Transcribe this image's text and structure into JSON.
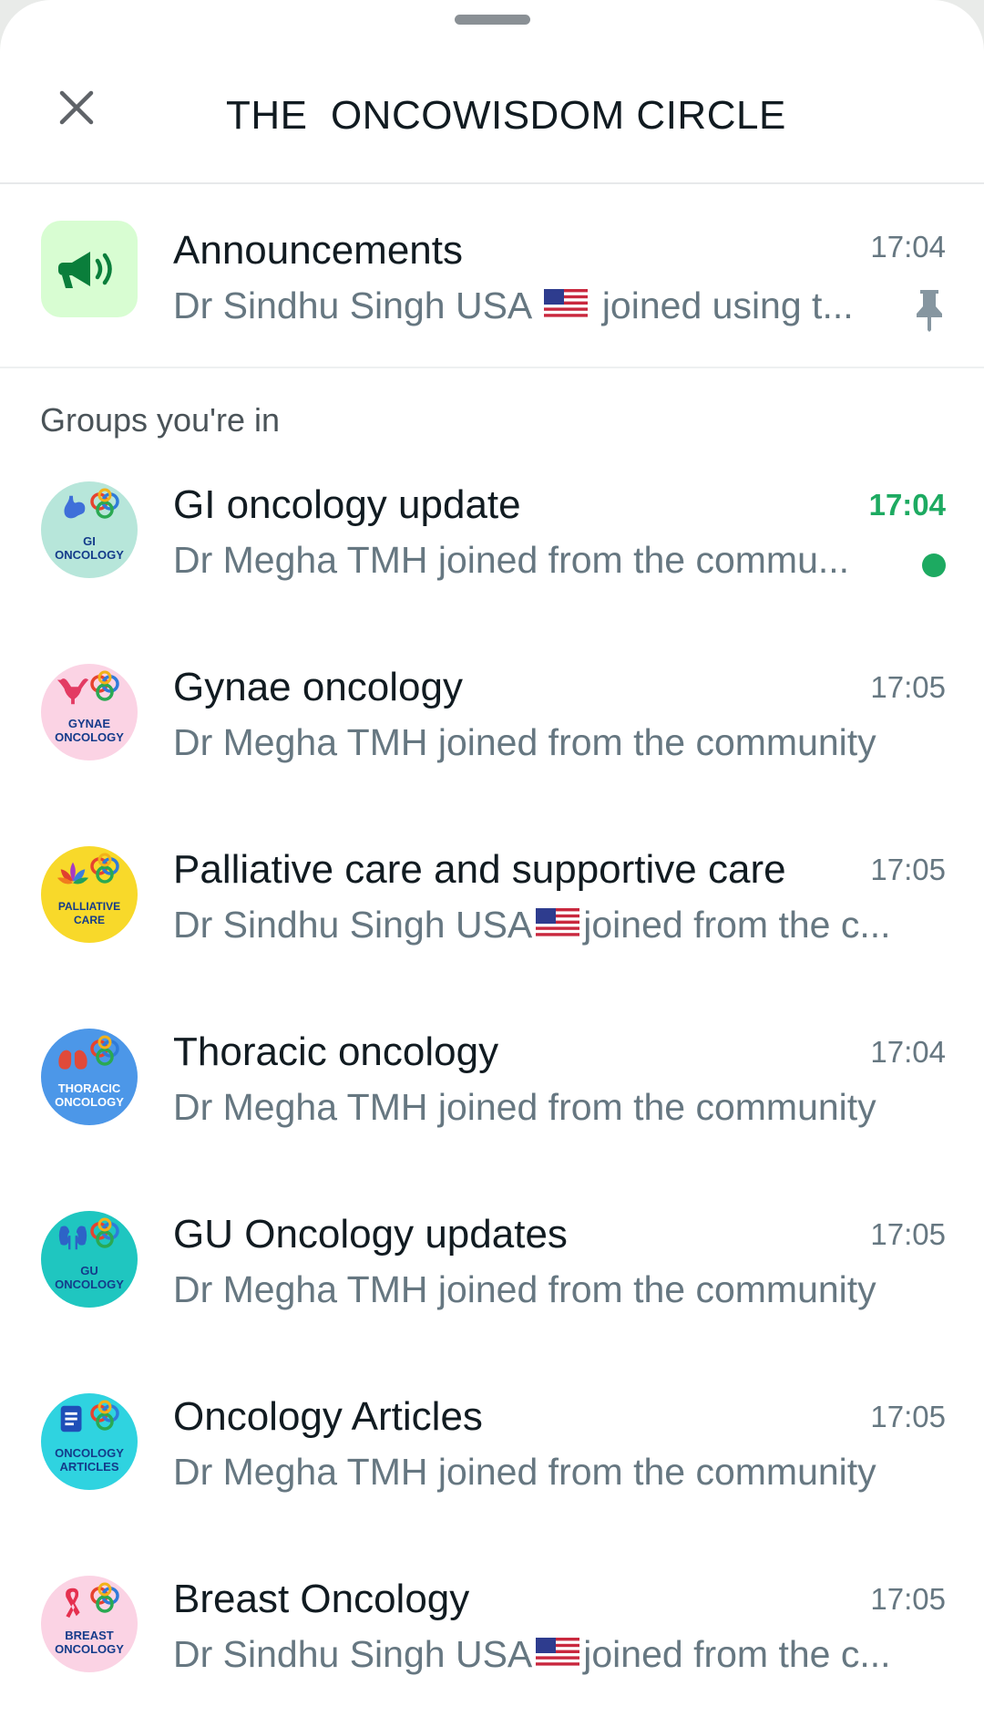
{
  "header": {
    "title": "THE  ONCOWISDOM CIRCLE"
  },
  "announcements": {
    "title": "Announcements",
    "subtitle_before_flag": "Dr Sindhu Singh USA",
    "subtitle_after_flag": "joined using t...",
    "time": "17:04"
  },
  "section_label": "Groups you're in",
  "groups": [
    {
      "title": "GI oncology update",
      "sub_before": "Dr Megha TMH joined from the commu...",
      "sub_after": "",
      "flag": false,
      "time": "17:04",
      "unread": true,
      "avatar_lines": [
        "GI",
        "ONCOLOGY"
      ],
      "avatar_bg": "#b7e6da",
      "avatar_icon": "stomach-icon"
    },
    {
      "title": "Gynae oncology",
      "sub_before": "Dr Megha TMH joined from the community",
      "sub_after": "",
      "flag": false,
      "time": "17:05",
      "unread": false,
      "avatar_lines": [
        "GYNAE",
        "ONCOLOGY"
      ],
      "avatar_bg": "#fbd3e4",
      "avatar_icon": "uterus-icon"
    },
    {
      "title": "Palliative care and supportive care",
      "sub_before": "Dr Sindhu Singh USA",
      "sub_after": "joined from the c...",
      "flag": true,
      "time": "17:05",
      "unread": false,
      "avatar_lines": [
        "PALLIATIVE",
        "CARE"
      ],
      "avatar_bg": "#f8d92a",
      "avatar_icon": "lotus-icon"
    },
    {
      "title": "Thoracic oncology",
      "sub_before": "Dr Megha TMH joined from the community",
      "sub_after": "",
      "flag": false,
      "time": "17:04",
      "unread": false,
      "avatar_lines": [
        "THORACIC",
        "ONCOLOGY"
      ],
      "avatar_bg": "#4c97e8",
      "avatar_icon": "lungs-icon"
    },
    {
      "title": "GU Oncology updates",
      "sub_before": "Dr Megha TMH joined from the community",
      "sub_after": "",
      "flag": false,
      "time": "17:05",
      "unread": false,
      "avatar_lines": [
        "GU",
        "ONCOLOGY"
      ],
      "avatar_bg": "#1fc6c0",
      "avatar_icon": "kidney-icon"
    },
    {
      "title": "Oncology Articles",
      "sub_before": "Dr Megha TMH joined from the community",
      "sub_after": "",
      "flag": false,
      "time": "17:05",
      "unread": false,
      "avatar_lines": [
        "ONCOLOGY",
        "ARTICLES"
      ],
      "avatar_bg": "#2fd3e0",
      "avatar_icon": "document-icon"
    },
    {
      "title": "Breast Oncology",
      "sub_before": "Dr Sindhu Singh USA",
      "sub_after": "joined from the c...",
      "flag": true,
      "time": "17:05",
      "unread": false,
      "avatar_lines": [
        "BREAST",
        "ONCOLOGY"
      ],
      "avatar_bg": "#fbd3e4",
      "avatar_icon": "ribbon-icon"
    }
  ],
  "colors": {
    "accent_green": "#1daa61",
    "muted_text": "#667781"
  }
}
